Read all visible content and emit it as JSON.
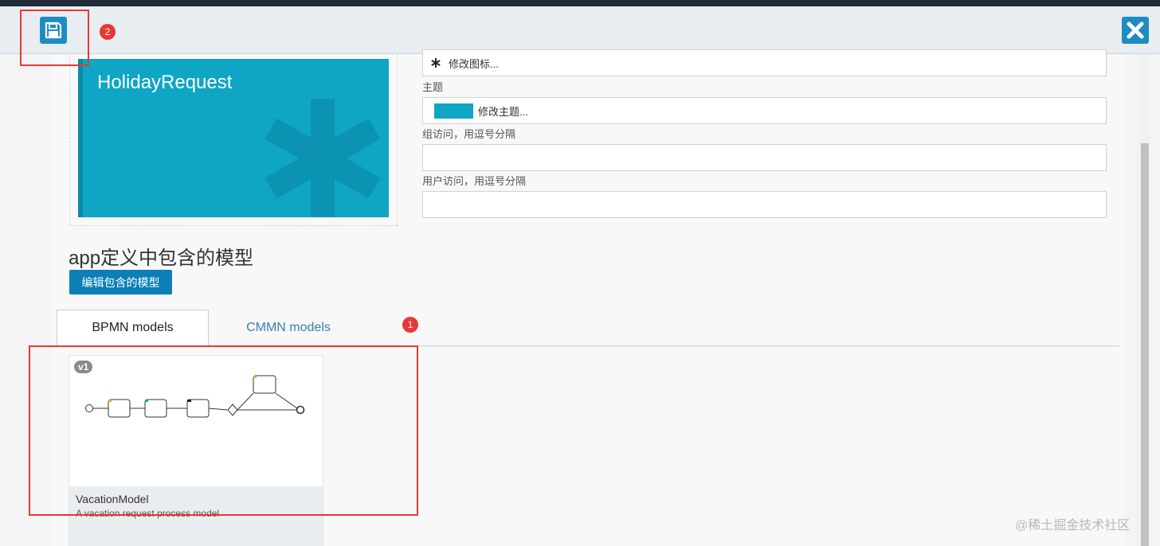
{
  "toolbar": {
    "save_icon": "floppy-disk-icon",
    "close_icon": "close-x-icon",
    "badge_save": "2"
  },
  "app": {
    "preview_title": "HolidayRequest",
    "icon_label": "修改图标...",
    "theme_label": "主题",
    "theme_value": "修改主题...",
    "group_label": "组访问，用逗号分隔",
    "group_value": "",
    "user_label": "用户访问，用逗号分隔",
    "user_value": ""
  },
  "models_section": {
    "title": "app定义中包含的模型",
    "edit_button": "编辑包含的模型",
    "tabs": [
      {
        "label": "BPMN models",
        "active": true
      },
      {
        "label": "CMMN models",
        "active": false
      }
    ],
    "badge_tabs": "1"
  },
  "model_card": {
    "version": "v1",
    "name": "VacationModel",
    "description": "A vacation request process model"
  },
  "watermark": "@稀土掘金技术社区",
  "colors": {
    "accent": "#1e8cc2",
    "theme": "#0ea6c4",
    "annotation": "#e53935"
  }
}
